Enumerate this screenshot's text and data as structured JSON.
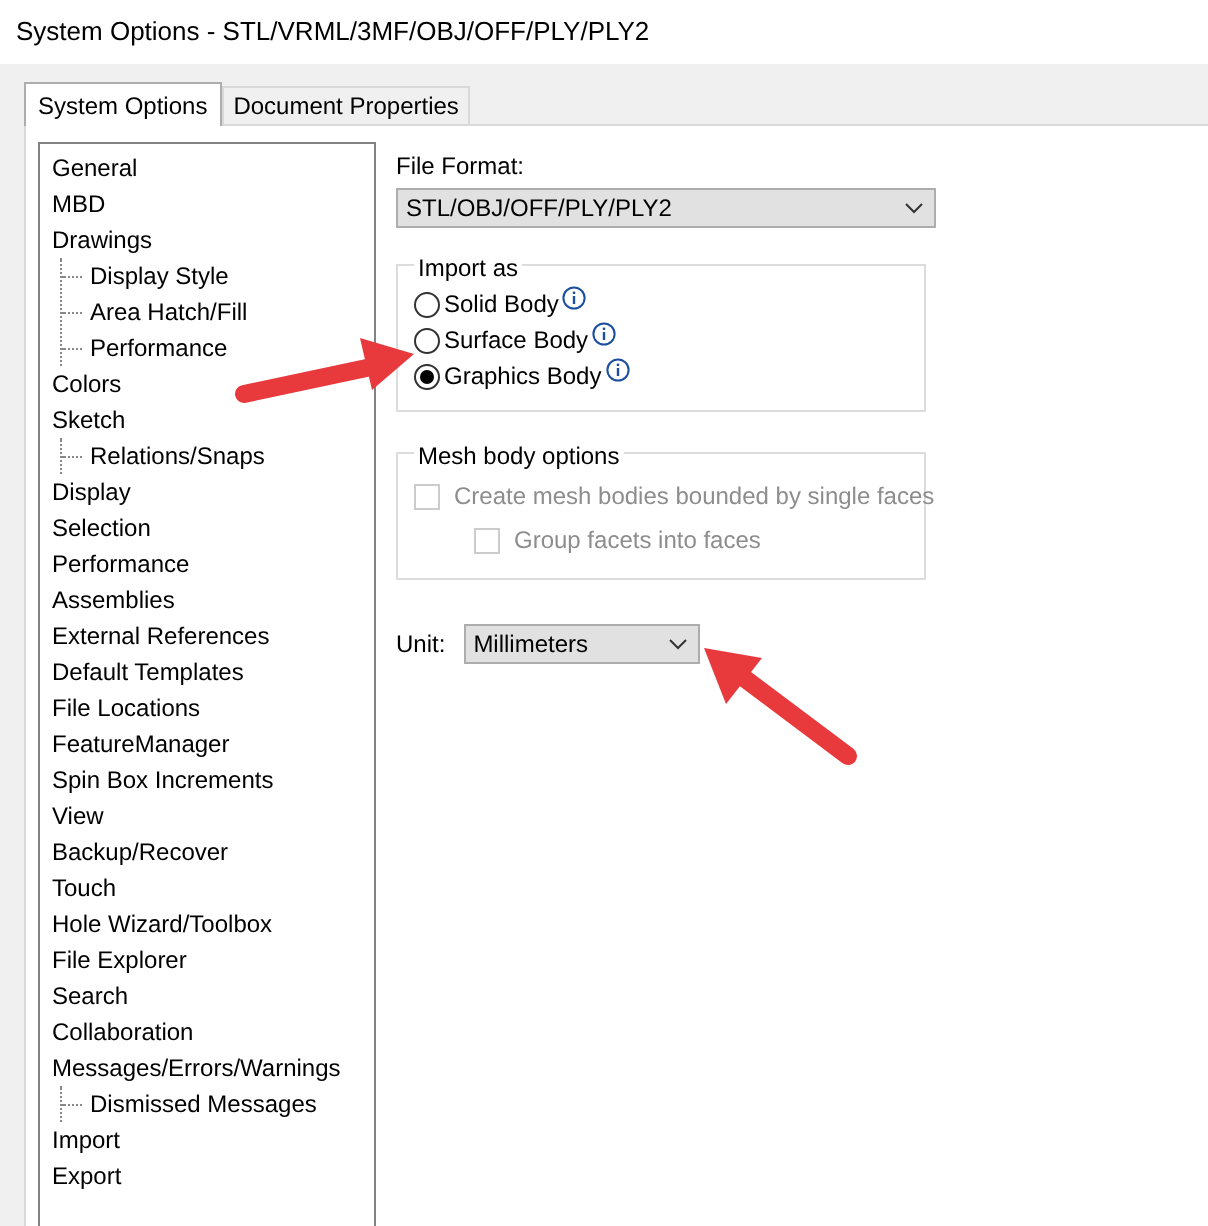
{
  "window": {
    "title": "System Options - STL/VRML/3MF/OBJ/OFF/PLY/PLY2"
  },
  "tabs": [
    {
      "label": "System Options",
      "selected": true
    },
    {
      "label": "Document Properties",
      "selected": false
    }
  ],
  "tree": [
    {
      "label": "General"
    },
    {
      "label": "MBD"
    },
    {
      "label": "Drawings",
      "children": [
        {
          "label": "Display Style"
        },
        {
          "label": "Area Hatch/Fill"
        },
        {
          "label": "Performance"
        }
      ]
    },
    {
      "label": "Colors"
    },
    {
      "label": "Sketch",
      "children": [
        {
          "label": "Relations/Snaps"
        }
      ]
    },
    {
      "label": "Display"
    },
    {
      "label": "Selection"
    },
    {
      "label": "Performance"
    },
    {
      "label": "Assemblies"
    },
    {
      "label": "External References"
    },
    {
      "label": "Default Templates"
    },
    {
      "label": "File Locations"
    },
    {
      "label": "FeatureManager"
    },
    {
      "label": "Spin Box Increments"
    },
    {
      "label": "View"
    },
    {
      "label": "Backup/Recover"
    },
    {
      "label": "Touch"
    },
    {
      "label": "Hole Wizard/Toolbox"
    },
    {
      "label": "File Explorer"
    },
    {
      "label": "Search"
    },
    {
      "label": "Collaboration"
    },
    {
      "label": "Messages/Errors/Warnings",
      "children": [
        {
          "label": "Dismissed Messages"
        }
      ]
    },
    {
      "label": "Import"
    },
    {
      "label": "Export"
    }
  ],
  "file_format": {
    "label": "File Format:",
    "value": "STL/OBJ/OFF/PLY/PLY2"
  },
  "import_as": {
    "title": "Import as",
    "options": [
      {
        "label": "Solid Body",
        "selected": false
      },
      {
        "label": "Surface Body",
        "selected": false
      },
      {
        "label": "Graphics Body",
        "selected": true
      }
    ]
  },
  "mesh_body_options": {
    "title": "Mesh body options",
    "options": [
      {
        "label": "Create mesh bodies bounded by single faces",
        "checked": false,
        "disabled": true,
        "children": [
          {
            "label": "Group facets into faces",
            "checked": false,
            "disabled": true
          }
        ]
      }
    ]
  },
  "unit": {
    "label": "Unit:",
    "value": "Millimeters"
  }
}
